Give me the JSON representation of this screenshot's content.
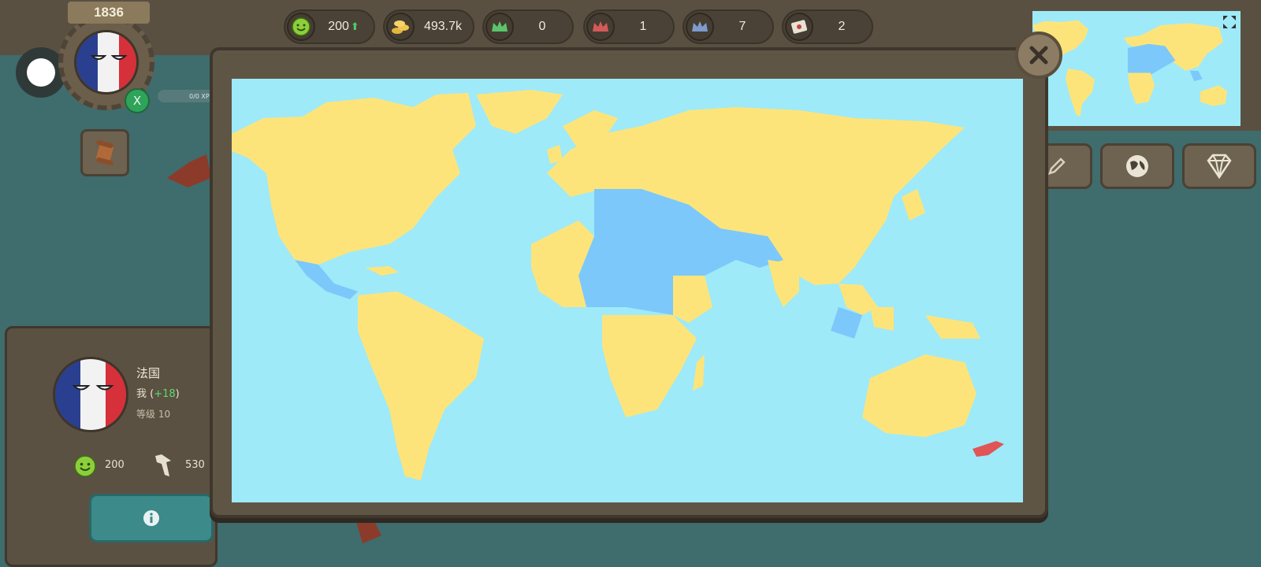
{
  "header": {
    "year": "1836",
    "resources": [
      {
        "icon": "happiness-icon",
        "value": "200",
        "trend": "up"
      },
      {
        "icon": "gold-coins-icon",
        "value": "493.7k",
        "trend": "up"
      },
      {
        "icon": "green-crown-icon",
        "value": "0",
        "trend": ""
      },
      {
        "icon": "red-crown-icon",
        "value": "1",
        "trend": ""
      },
      {
        "icon": "blue-crown-icon",
        "value": "7",
        "trend": ""
      },
      {
        "icon": "letter-icon",
        "value": "2",
        "trend": ""
      }
    ]
  },
  "player": {
    "x_badge": "X",
    "xp_label": "0/0 XP",
    "name": "法国",
    "relation": "我",
    "relation_bonus": "+18",
    "level_label": "等级 10",
    "happiness": "200",
    "troops": "530"
  },
  "colors": {
    "ocean": "#9eeaf9",
    "owned_land": "#fde47a",
    "other_land": "#7cc8fa",
    "enemy": "#e05555",
    "accent_green": "#5bdc6b"
  }
}
